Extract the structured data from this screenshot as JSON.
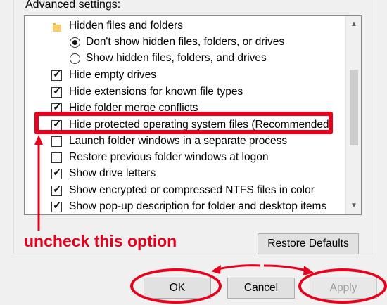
{
  "group": {
    "title": "Advanced settings:"
  },
  "list": [
    {
      "type": "folder",
      "label": "Hidden files and folders"
    },
    {
      "type": "radio",
      "checked": true,
      "label": "Don't show hidden files, folders, or drives"
    },
    {
      "type": "radio",
      "checked": false,
      "label": "Show hidden files, folders, and drives"
    },
    {
      "type": "checkbox",
      "checked": true,
      "label": "Hide empty drives"
    },
    {
      "type": "checkbox",
      "checked": true,
      "label": "Hide extensions for known file types"
    },
    {
      "type": "checkbox",
      "checked": true,
      "label": "Hide folder merge conflicts"
    },
    {
      "type": "checkbox",
      "checked": true,
      "label": "Hide protected operating system files (Recommended)"
    },
    {
      "type": "checkbox",
      "checked": false,
      "label": "Launch folder windows in a separate process"
    },
    {
      "type": "checkbox",
      "checked": false,
      "label": "Restore previous folder windows at logon"
    },
    {
      "type": "checkbox",
      "checked": true,
      "label": "Show drive letters"
    },
    {
      "type": "checkbox",
      "checked": true,
      "label": "Show encrypted or compressed NTFS files in color"
    },
    {
      "type": "checkbox",
      "checked": true,
      "label": "Show pop-up description for folder and desktop items"
    }
  ],
  "buttons": {
    "restore_defaults": "Restore Defaults",
    "ok": "OK",
    "cancel": "Cancel",
    "apply": "Apply"
  },
  "annotation": {
    "text": "uncheck this option"
  },
  "colors": {
    "annotation_red": "#e8001c",
    "window_bg": "#f0f0f0"
  }
}
